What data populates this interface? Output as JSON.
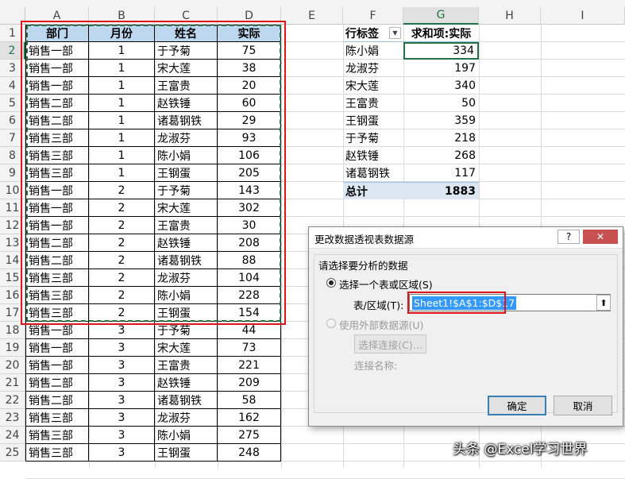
{
  "columns": [
    "A",
    "B",
    "C",
    "D",
    "E",
    "F",
    "G",
    "H",
    "I"
  ],
  "rows": [
    "1",
    "2",
    "3",
    "4",
    "5",
    "6",
    "7",
    "8",
    "9",
    "10",
    "11",
    "12",
    "13",
    "14",
    "15",
    "16",
    "17",
    "18",
    "19",
    "20",
    "21",
    "22",
    "23",
    "24",
    "25"
  ],
  "table": {
    "headers": [
      "部门",
      "月份",
      "姓名",
      "实际"
    ],
    "records": [
      [
        "销售一部",
        "1",
        "于予菊",
        "75"
      ],
      [
        "销售一部",
        "1",
        "宋大莲",
        "38"
      ],
      [
        "销售一部",
        "1",
        "王富贵",
        "20"
      ],
      [
        "销售二部",
        "1",
        "赵铁锤",
        "60"
      ],
      [
        "销售二部",
        "1",
        "诸葛钢铁",
        "29"
      ],
      [
        "销售三部",
        "1",
        "龙淑芬",
        "93"
      ],
      [
        "销售三部",
        "1",
        "陈小娟",
        "106"
      ],
      [
        "销售三部",
        "1",
        "王钢蛋",
        "205"
      ],
      [
        "销售一部",
        "2",
        "于予菊",
        "143"
      ],
      [
        "销售一部",
        "2",
        "宋大莲",
        "302"
      ],
      [
        "销售一部",
        "2",
        "王富贵",
        "30"
      ],
      [
        "销售二部",
        "2",
        "赵铁锤",
        "208"
      ],
      [
        "销售二部",
        "2",
        "诸葛钢铁",
        "88"
      ],
      [
        "销售三部",
        "2",
        "龙淑芬",
        "104"
      ],
      [
        "销售三部",
        "2",
        "陈小娟",
        "228"
      ],
      [
        "销售三部",
        "2",
        "王钢蛋",
        "154"
      ],
      [
        "销售一部",
        "3",
        "于予菊",
        "44"
      ],
      [
        "销售一部",
        "3",
        "宋大莲",
        "73"
      ],
      [
        "销售一部",
        "3",
        "王富贵",
        "221"
      ],
      [
        "销售二部",
        "3",
        "赵铁锤",
        "209"
      ],
      [
        "销售二部",
        "3",
        "诸葛钢铁",
        "58"
      ],
      [
        "销售三部",
        "3",
        "龙淑芬",
        "162"
      ],
      [
        "销售三部",
        "3",
        "陈小娟",
        "275"
      ],
      [
        "销售三部",
        "3",
        "王钢蛋",
        "248"
      ]
    ]
  },
  "pivot": {
    "row_label": "行标签",
    "filter_glyph": "▼",
    "value_label": "求和项:实际",
    "items": [
      {
        "name": "陈小娟",
        "value": "334"
      },
      {
        "name": "龙淑芬",
        "value": "197"
      },
      {
        "name": "宋大莲",
        "value": "340"
      },
      {
        "name": "王富贵",
        "value": "50"
      },
      {
        "name": "王钢蛋",
        "value": "359"
      },
      {
        "name": "于予菊",
        "value": "218"
      },
      {
        "name": "赵铁锤",
        "value": "268"
      },
      {
        "name": "诸葛钢铁",
        "value": "117"
      }
    ],
    "total_label": "总计",
    "total_value": "1883"
  },
  "dialog": {
    "title": "更改数据透视表数据源",
    "help": "?",
    "close": "✕",
    "section": "请选择要分析的数据",
    "option_range": "选择一个表或区域(S)",
    "range_label": "表/区域(T):",
    "range_value": "Sheet1!$A$1:$D$17",
    "collapse_glyph": "⬆",
    "option_external": "使用外部数据源(U)",
    "choose_conn": "选择连接(C)...",
    "conn_name": "连接名称:",
    "ok": "确定",
    "cancel": "取消"
  },
  "watermark": "头条 @Excel学习世界",
  "colors": {
    "header_fill": "#bdd7ee",
    "highlight": "#e0141a",
    "selection": "#217346",
    "pivot_total": "#dce6f1"
  }
}
